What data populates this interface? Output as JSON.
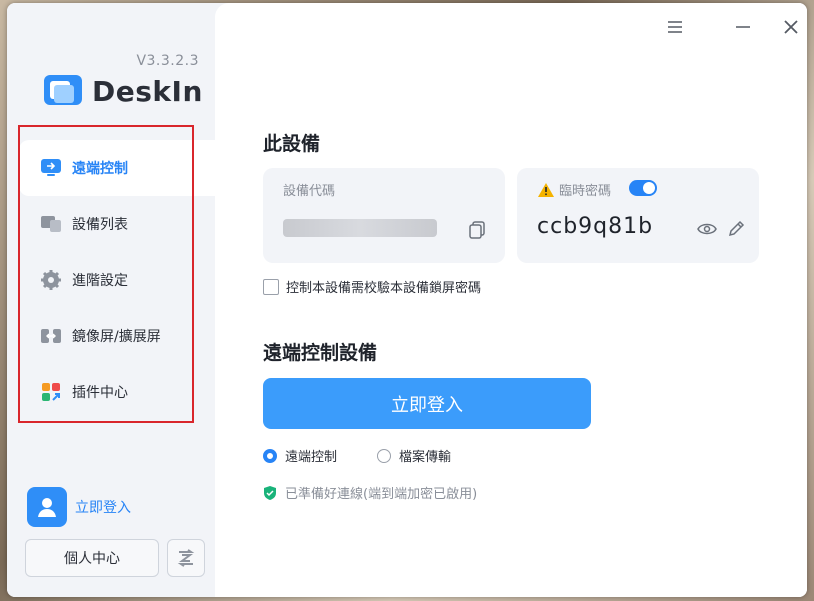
{
  "app": {
    "version": "V3.3.2.3",
    "name": "DeskIn"
  },
  "sidebar": {
    "items": [
      {
        "label": "遠端控制",
        "icon": "remote-control-icon",
        "active": true
      },
      {
        "label": "設備列表",
        "icon": "device-list-icon",
        "active": false
      },
      {
        "label": "進階設定",
        "icon": "gear-icon",
        "active": false
      },
      {
        "label": "鏡像屏/擴展屏",
        "icon": "mirror-screen-icon",
        "active": false
      },
      {
        "label": "插件中心",
        "icon": "plugin-center-icon",
        "active": false
      }
    ],
    "login_label": "立即登入",
    "profile_label": "個人中心"
  },
  "main": {
    "this_device": {
      "title": "此設備",
      "device_code_label": "設備代碼",
      "device_code_value": "[hidden]",
      "temp_password_label": "臨時密碼",
      "temp_password_value": "ccb9q81b",
      "temp_password_enabled": true,
      "lock_password_checkbox": "控制本設備需校驗本設備鎖屏密碼",
      "lock_password_checked": false
    },
    "remote": {
      "title": "遠端控制設備",
      "login_button": "立即登入",
      "modes": [
        {
          "label": "遠端控制",
          "selected": true
        },
        {
          "label": "檔案傳輸",
          "selected": false
        }
      ],
      "status": "已準備好連線(端到端加密已啟用)"
    }
  },
  "colors": {
    "accent": "#2784f6",
    "button": "#3b9cfb",
    "highlight_border": "#d9262c"
  }
}
